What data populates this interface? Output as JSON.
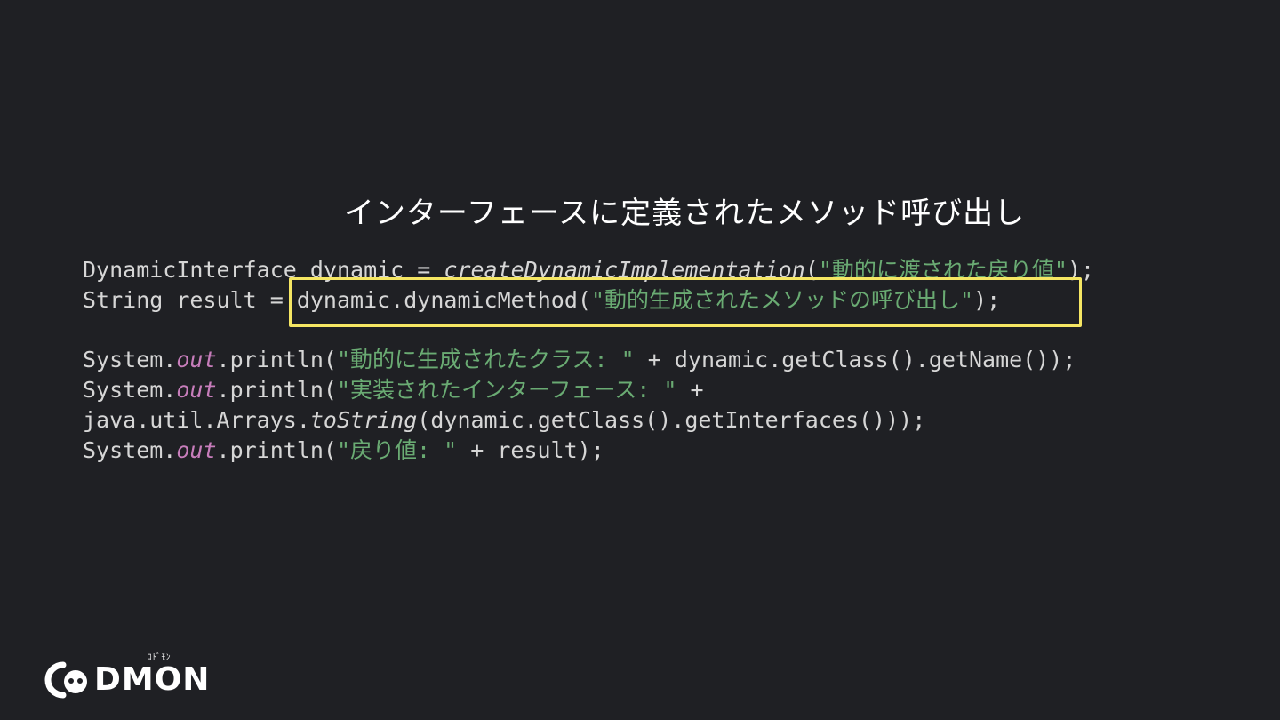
{
  "slide": {
    "title": "インターフェースに定義されたメソッド呼び出し"
  },
  "code": {
    "l1_type": "DynamicInterface dynamic = ",
    "l1_method": "createDynamicImplementation",
    "l1_open": "(",
    "l1_str": "\"動的に渡された戻り値\"",
    "l1_close": ");",
    "l2_prefix": "String result = ",
    "l2_call": "dynamic.dynamicMethod(",
    "l2_str": "\"動的生成されたメソッドの呼び出し\"",
    "l2_close": ");",
    "l3_system": "System.",
    "l3_out": "out",
    "l3_println": ".println(",
    "l3_str": "\"動的に生成されたクラス: \"",
    "l3_rest": " + dynamic.getClass().getName());",
    "l4_system": "System.",
    "l4_out": "out",
    "l4_println": ".println(",
    "l4_str": "\"実装されたインターフェース: \"",
    "l4_rest": " +",
    "l5_prefix": "java.util.Arrays.",
    "l5_method": "toString",
    "l5_rest": "(dynamic.getClass().getInterfaces()));",
    "l6_system": "System.",
    "l6_out": "out",
    "l6_println": ".println(",
    "l6_str": "\"戻り値: \"",
    "l6_rest": " + result);"
  },
  "logo": {
    "text": "DMON",
    "small": "ｺﾄﾞﾓﾝ",
    "alt_name": "CODMON"
  },
  "colors": {
    "background": "#1f2024",
    "string": "#6aab73",
    "field": "#c77dbb",
    "highlight": "#f5e663"
  }
}
